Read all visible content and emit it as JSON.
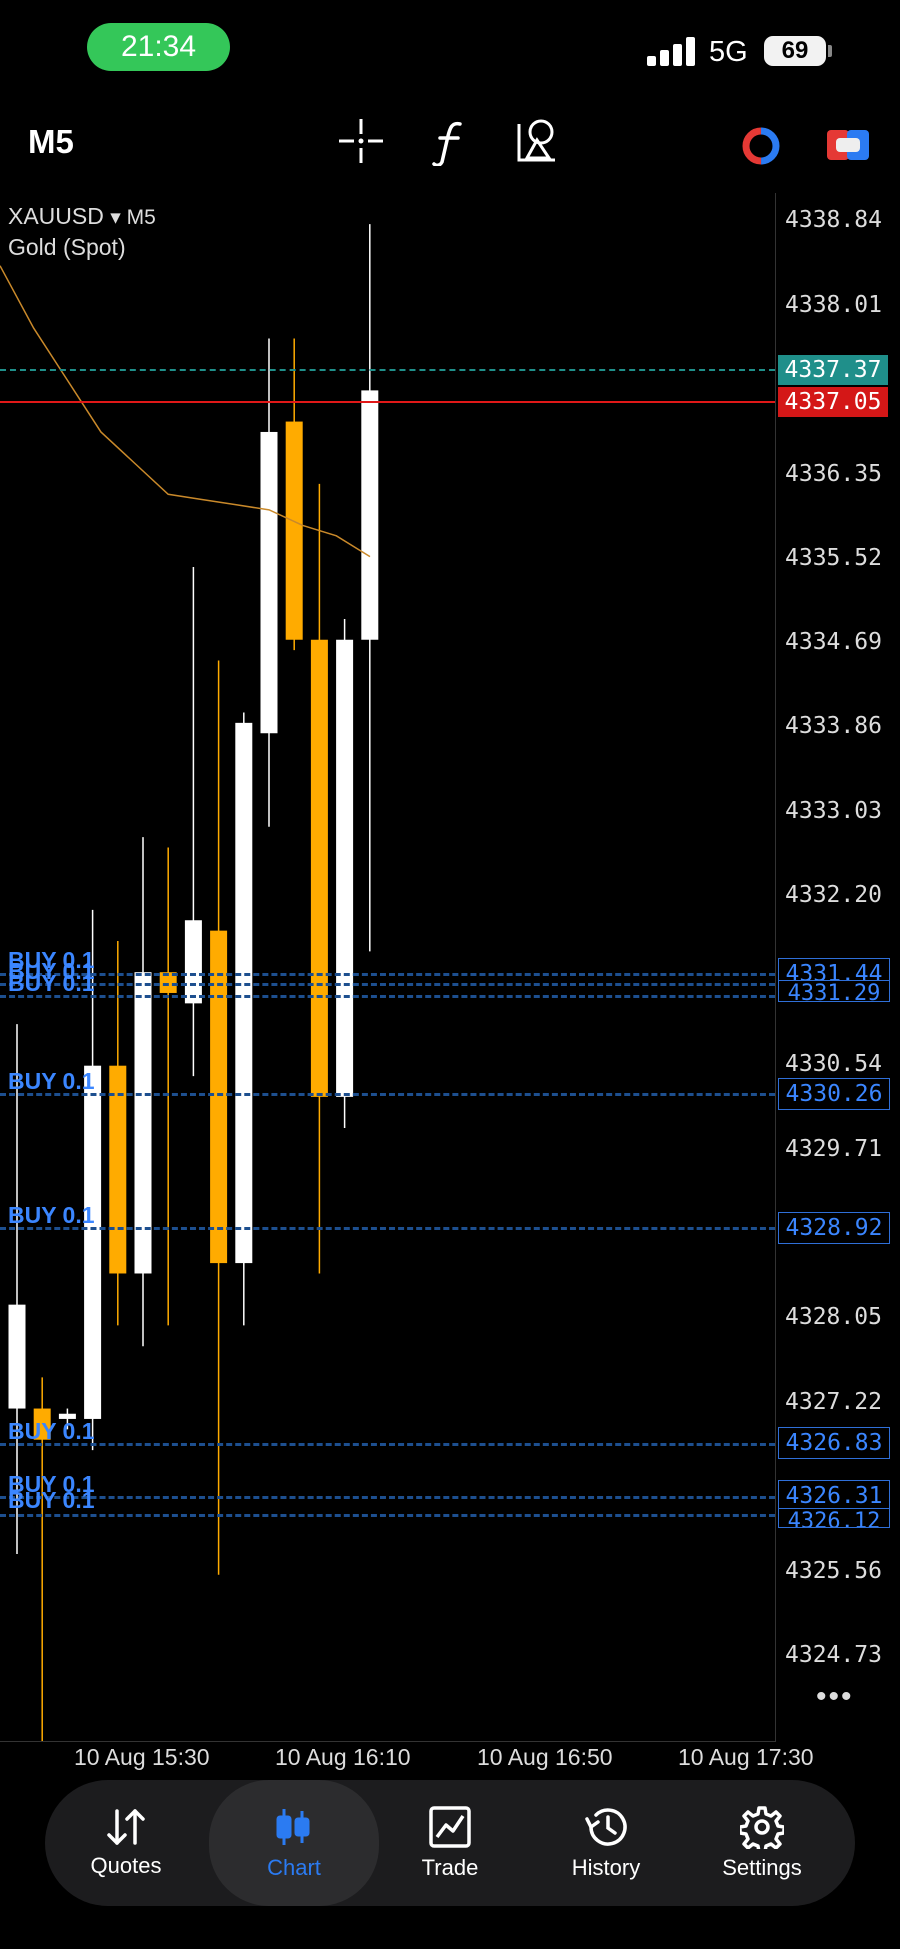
{
  "status_bar": {
    "time": "21:34",
    "network": "5G",
    "battery": "69"
  },
  "toolbar": {
    "timeframe": "M5"
  },
  "chart": {
    "symbol": "XAUUSD",
    "symbol_suffix": "▾ M5",
    "description": "Gold (Spot)",
    "price_labels": [
      "4338.84",
      "4338.01",
      "4336.35",
      "4335.52",
      "4334.69",
      "4333.86",
      "4333.03",
      "4332.20",
      "4330.54",
      "4329.71",
      "4328.05",
      "4327.22",
      "4325.56",
      "4324.73"
    ],
    "ask_price": "4337.37",
    "bid_price": "4337.05",
    "order_tags": [
      "4331.44",
      "4331.29",
      "4330.26",
      "4328.92",
      "4326.83",
      "4326.31",
      "4326.12"
    ],
    "buy_labels": [
      "BUY 0.1",
      "BUY 0.1",
      "BUY 0.1",
      "BUY 0.1",
      "BUY 0.1",
      "BUY 0.1",
      "BUY 0.1",
      "BUY 0.1"
    ],
    "time_labels": [
      "10 Aug 15:30",
      "10 Aug 16:10",
      "10 Aug 16:50",
      "10 Aug 17:30"
    ],
    "more": "•••",
    "colors": {
      "bull": "#ffffff",
      "bear": "#ffab00",
      "ask_line": "#1f8f8a",
      "bid_line": "#e11818",
      "order_line": "#2f6fd8",
      "ma_line": "#c9892a"
    }
  },
  "chart_data": {
    "type": "candlestick",
    "ylim": [
      4324.4,
      4339.3
    ],
    "candles": [
      {
        "open": 4327.6,
        "high": 4331.3,
        "low": 4326.2,
        "close": 4328.6
      },
      {
        "open": 4327.6,
        "high": 4327.9,
        "low": 4324.4,
        "close": 4327.3
      },
      {
        "open": 4327.5,
        "high": 4327.6,
        "low": 4327.4,
        "close": 4327.55
      },
      {
        "open": 4327.5,
        "high": 4332.4,
        "low": 4327.2,
        "close": 4330.9
      },
      {
        "open": 4330.9,
        "high": 4332.1,
        "low": 4328.4,
        "close": 4328.9
      },
      {
        "open": 4328.9,
        "high": 4333.1,
        "low": 4328.2,
        "close": 4331.8
      },
      {
        "open": 4331.8,
        "high": 4333.0,
        "low": 4328.4,
        "close": 4331.6
      },
      {
        "open": 4331.5,
        "high": 4335.7,
        "low": 4330.8,
        "close": 4332.3
      },
      {
        "open": 4332.2,
        "high": 4334.8,
        "low": 4326.0,
        "close": 4329.0
      },
      {
        "open": 4329.0,
        "high": 4334.3,
        "low": 4328.4,
        "close": 4334.2
      },
      {
        "open": 4334.1,
        "high": 4337.9,
        "low": 4333.2,
        "close": 4337.0
      },
      {
        "open": 4337.1,
        "high": 4337.9,
        "low": 4334.9,
        "close": 4335.0
      },
      {
        "open": 4335.0,
        "high": 4336.5,
        "low": 4328.9,
        "close": 4330.6
      },
      {
        "open": 4330.6,
        "high": 4335.2,
        "low": 4330.3,
        "close": 4335.0
      },
      {
        "open": 4335.0,
        "high": 4339.0,
        "low": 4332.0,
        "close": 4337.4
      }
    ],
    "moving_average": [
      4338.6,
      4338.0,
      4337.5,
      4337.0,
      4336.7,
      4336.4,
      4336.35,
      4336.3,
      4336.25,
      4336.1,
      4336.0,
      4335.8
    ]
  },
  "nav": {
    "items": [
      {
        "label": "Quotes"
      },
      {
        "label": "Chart"
      },
      {
        "label": "Trade"
      },
      {
        "label": "History"
      },
      {
        "label": "Settings"
      }
    ]
  }
}
